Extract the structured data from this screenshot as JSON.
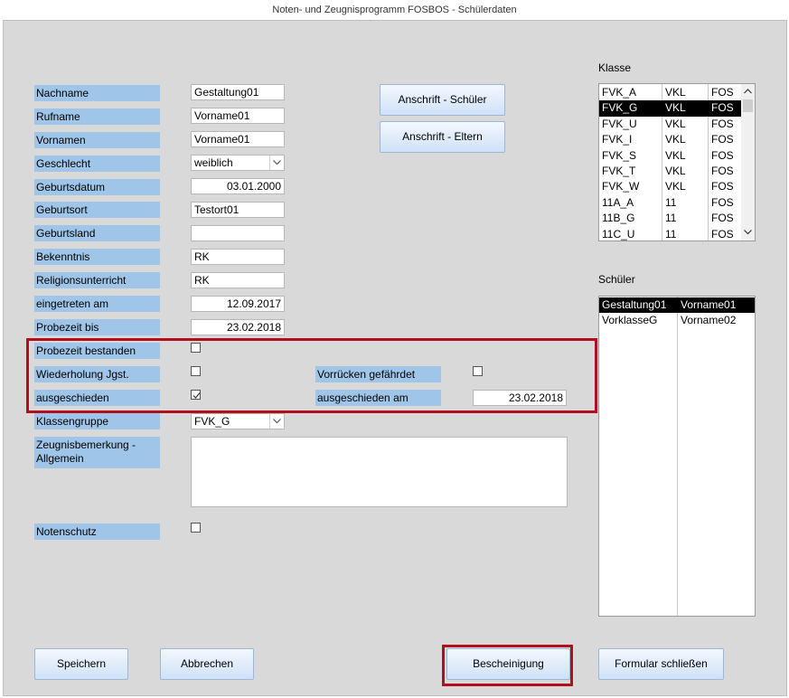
{
  "window": {
    "title": "Noten- und Zeugnisprogramm FOSBOS - Schülerdaten"
  },
  "fields": {
    "nachname": {
      "label": "Nachname",
      "value": "Gestaltung01"
    },
    "rufname": {
      "label": "Rufname",
      "value": "Vorname01"
    },
    "vornamen": {
      "label": "Vornamen",
      "value": "Vorname01"
    },
    "geschlecht": {
      "label": "Geschlecht",
      "value": "weiblich"
    },
    "geburtsdatum": {
      "label": "Geburtsdatum",
      "value": "03.01.2000"
    },
    "geburtsort": {
      "label": "Geburtsort",
      "value": "Testort01"
    },
    "geburtsland": {
      "label": "Geburtsland",
      "value": ""
    },
    "bekenntnis": {
      "label": "Bekenntnis",
      "value": "RK"
    },
    "religionsunterricht": {
      "label": "Religionsunterricht",
      "value": "RK"
    },
    "eingetreten": {
      "label": "eingetreten am",
      "value": "12.09.2017"
    },
    "probezeit_bis": {
      "label": "Probezeit bis",
      "value": "23.02.2018"
    },
    "probezeit_bestanden": {
      "label": "Probezeit bestanden",
      "checked": false
    },
    "wiederholung": {
      "label": "Wiederholung Jgst.",
      "checked": false
    },
    "ausgeschieden": {
      "label": "ausgeschieden",
      "checked": true
    },
    "vorruecken": {
      "label": "Vorrücken gefährdet",
      "checked": false
    },
    "ausgeschieden_am": {
      "label": "ausgeschieden am",
      "value": "23.02.2018"
    },
    "klassengruppe": {
      "label": "Klassengruppe",
      "value": "FVK_G"
    },
    "zeugnisbemerkung": {
      "label": "Zeugnisbemerkung -\nAllgemein",
      "value": ""
    },
    "notenschutz": {
      "label": "Notenschutz",
      "checked": false
    }
  },
  "buttons": {
    "anschrift_schueler": "Anschrift - Schüler",
    "anschrift_eltern": "Anschrift - Eltern",
    "speichern": "Speichern",
    "abbrechen": "Abbrechen",
    "bescheinigung": "Bescheinigung",
    "schliessen": "Formular schließen"
  },
  "klasse": {
    "title": "Klasse",
    "selected_index": 1,
    "rows": [
      [
        "FVK_A",
        "VKL",
        "FOS"
      ],
      [
        "FVK_G",
        "VKL",
        "FOS"
      ],
      [
        "FVK_U",
        "VKL",
        "FOS"
      ],
      [
        "FVK_I",
        "VKL",
        "FOS"
      ],
      [
        "FVK_S",
        "VKL",
        "FOS"
      ],
      [
        "FVK_T",
        "VKL",
        "FOS"
      ],
      [
        "FVK_W",
        "VKL",
        "FOS"
      ],
      [
        "11A_A",
        "11",
        "FOS"
      ],
      [
        "11B_G",
        "11",
        "FOS"
      ],
      [
        "11C_U",
        "11",
        "FOS"
      ]
    ]
  },
  "schueler": {
    "title": "Schüler",
    "selected_index": 0,
    "rows": [
      [
        "Gestaltung01",
        "Vorname01"
      ],
      [
        "VorklasseG",
        "Vorname02"
      ]
    ]
  },
  "colors": {
    "label_bg": "#9fc5e8",
    "highlight_border": "#b0101e",
    "form_bg": "#d9d9d9"
  }
}
